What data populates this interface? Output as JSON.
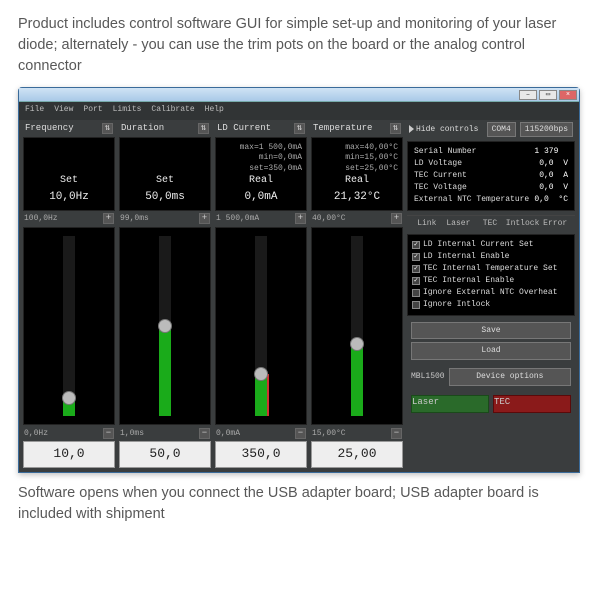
{
  "text": {
    "desc_top": "Product includes control software GUI for simple set-up and monitoring of your laser diode; alternately - you can use the trim pots on the board or the analog control connector",
    "desc_bottom": "Software opens when you connect the USB adapter board; USB adapter board is included with shipment"
  },
  "menubar": [
    "File",
    "View",
    "Port",
    "Limits",
    "Calibrate",
    "Help"
  ],
  "top_right": {
    "hide_controls": "Hide controls",
    "port": "COM4",
    "baud": "115200bps"
  },
  "channels": [
    {
      "title": "Frequency",
      "extras": [],
      "big_label": "Set",
      "big_value": "10,0Hz",
      "max_label": "100,0Hz",
      "min_label": "0,0Hz",
      "input_value": "10,0",
      "fill_pct": 10
    },
    {
      "title": "Duration",
      "extras": [],
      "big_label": "Set",
      "big_value": "50,0ms",
      "max_label": "99,0ms",
      "min_label": "1,0ms",
      "input_value": "50,0",
      "fill_pct": 50
    },
    {
      "title": "LD Current",
      "extras": [
        "max=1 500,0mA",
        "min=0,0mA",
        "set=350,0mA"
      ],
      "big_label": "Real",
      "big_value": "0,0mA",
      "max_label": "1 500,0mA",
      "min_label": "0,0mA",
      "input_value": "350,0",
      "fill_pct": 23,
      "red": true
    },
    {
      "title": "Temperature",
      "extras": [
        "max=40,00°C",
        "min=15,00°C",
        "set=25,00°C"
      ],
      "big_label": "Real",
      "big_value": "21,32°C",
      "max_label": "40,00°C",
      "min_label": "15,00°C",
      "input_value": "25,00",
      "fill_pct": 40
    }
  ],
  "info": [
    {
      "k": "Serial Number",
      "v": "1 379",
      "u": ""
    },
    {
      "k": "LD Voltage",
      "v": "0,0",
      "u": "V"
    },
    {
      "k": "TEC Current",
      "v": "0,0",
      "u": "A"
    },
    {
      "k": "TEC Voltage",
      "v": "0,0",
      "u": "V"
    },
    {
      "k": "External NTC Temperature",
      "v": "0,0",
      "u": "°C"
    }
  ],
  "status_tabs": [
    "Link",
    "Laser",
    "TEC",
    "Intlock",
    "Error"
  ],
  "flags": [
    {
      "label": "LD Internal Current Set",
      "checked": true
    },
    {
      "label": "LD Internal Enable",
      "checked": true
    },
    {
      "label": "TEC Internal Temperature Set",
      "checked": true
    },
    {
      "label": "TEC Internal Enable",
      "checked": true
    },
    {
      "label": "Ignore External NTC Overheat",
      "checked": false
    },
    {
      "label": "Ignore Intlock",
      "checked": false
    }
  ],
  "buttons": {
    "save": "Save",
    "load": "Load",
    "device_name": "MBL1500",
    "device_options": "Device options",
    "laser": "Laser",
    "tec": "TEC"
  }
}
